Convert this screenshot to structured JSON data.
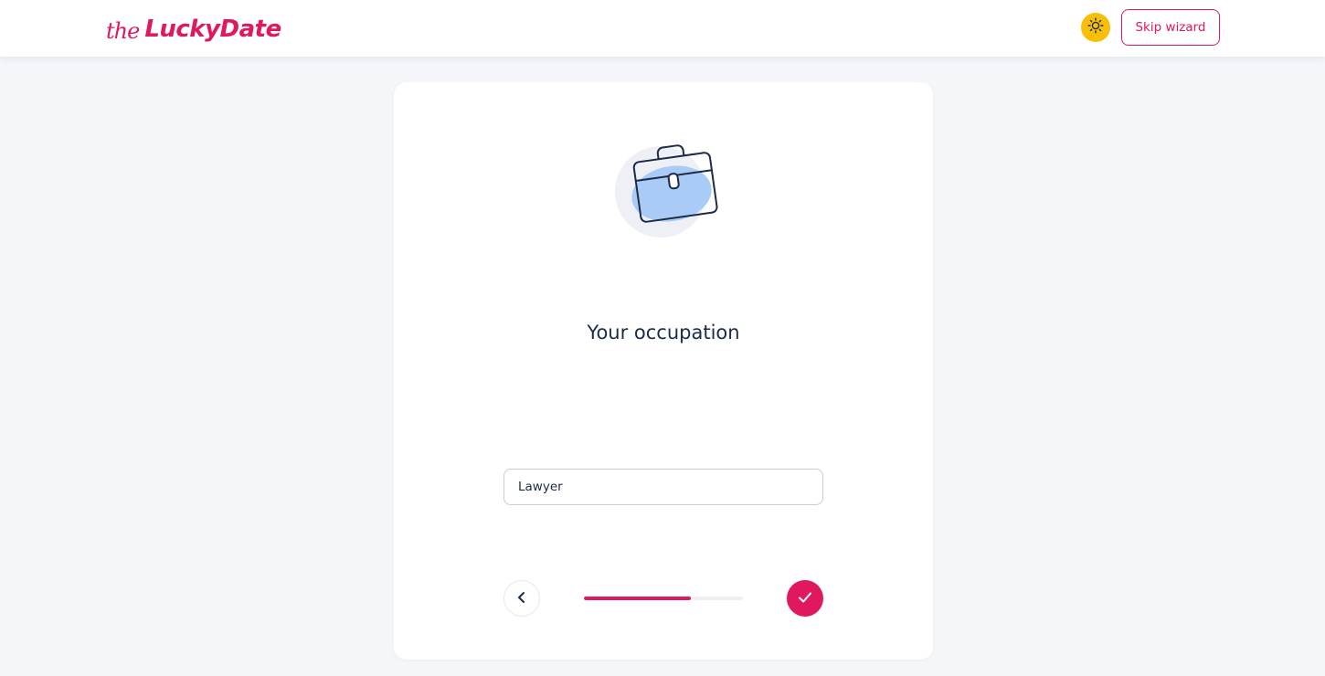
{
  "header": {
    "logo_prefix": "the",
    "logo_name": "LuckyDate",
    "theme_toggle_icon": "sun-icon",
    "skip_label": "Skip wizard"
  },
  "wizard": {
    "illustration_icon": "briefcase-icon",
    "title": "Your occupation",
    "input_value": "Lawyer",
    "progress_fraction": 0.67,
    "back_icon": "chevron-left-icon",
    "confirm_icon": "checkmark-icon"
  },
  "colors": {
    "brand": "#e0185f",
    "theme_toggle": "#f8bf09",
    "background": "#f4f6fa",
    "text": "#1c2b46"
  }
}
